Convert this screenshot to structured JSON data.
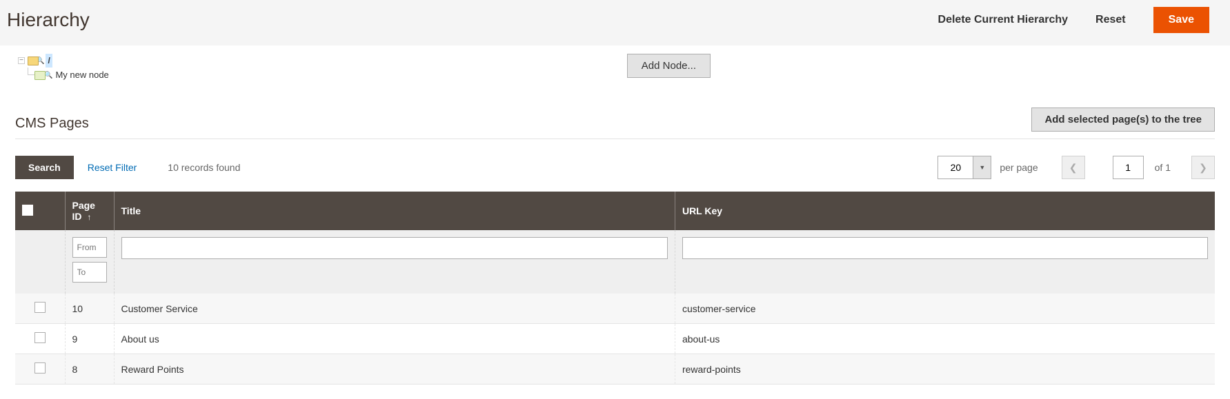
{
  "header": {
    "title": "Hierarchy",
    "delete_label": "Delete Current Hierarchy",
    "reset_label": "Reset",
    "save_label": "Save"
  },
  "tree": {
    "root_label": "/",
    "child_label": "My new node",
    "add_node_label": "Add Node..."
  },
  "cms_section": {
    "title": "CMS Pages",
    "add_selected_label": "Add selected page(s) to the tree"
  },
  "toolbar": {
    "search_label": "Search",
    "reset_filter_label": "Reset Filter",
    "records_text": "10 records found",
    "page_size": "20",
    "per_page_label": "per page",
    "page_num": "1",
    "of_text": "of 1"
  },
  "columns": {
    "page_id": "Page ID",
    "title": "Title",
    "url_key": "URL Key"
  },
  "filters": {
    "from_placeholder": "From",
    "to_placeholder": "To"
  },
  "rows": [
    {
      "id": "10",
      "title": "Customer Service",
      "url": "customer-service"
    },
    {
      "id": "9",
      "title": "About us",
      "url": "about-us"
    },
    {
      "id": "8",
      "title": "Reward Points",
      "url": "reward-points"
    }
  ]
}
